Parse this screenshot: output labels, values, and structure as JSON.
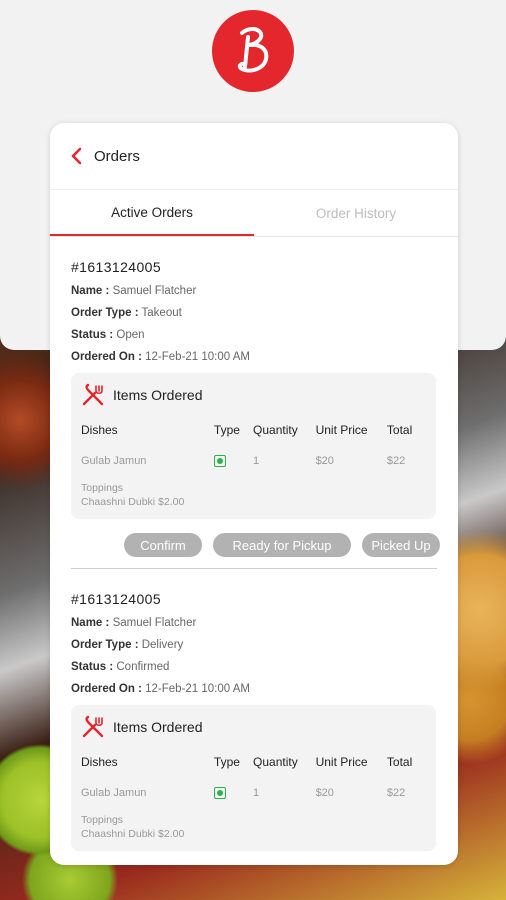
{
  "brand": {
    "color": "#e4262d",
    "logo_letter": "B"
  },
  "header": {
    "title": "Orders",
    "back_icon": "chevron-left-icon"
  },
  "tabs": [
    {
      "label": "Active Orders",
      "active": true
    },
    {
      "label": "Order History",
      "active": false
    }
  ],
  "table_headers": {
    "dishes": "Dishes",
    "type": "Type",
    "quantity": "Quantity",
    "unit_price": "Unit Price",
    "total": "Total"
  },
  "items_title": "Items Ordered",
  "actions": {
    "confirm": "Confirm",
    "ready": "Ready for Pickup",
    "picked": "Picked Up"
  },
  "orders": [
    {
      "id": "#1613124005",
      "name_label": "Name :",
      "name": "Samuel Flatcher",
      "type_label": "Order Type :",
      "type": "Takeout",
      "status_label": "Status :",
      "status": "Open",
      "ordered_label": "Ordered On :",
      "ordered_on": "12-Feb-21 10:00 AM",
      "items": [
        {
          "dish": "Gulab Jamun",
          "veg": true,
          "quantity": "1",
          "unit_price": "$20",
          "total": "$22",
          "toppings_label": "Toppings",
          "toppings": "Chaashni Dubki $2.00"
        }
      ]
    },
    {
      "id": "#1613124005",
      "name_label": "Name :",
      "name": "Samuel Flatcher",
      "type_label": "Order Type :",
      "type": "Delivery",
      "status_label": "Status :",
      "status": "Confirmed",
      "ordered_label": "Ordered On :",
      "ordered_on": "12-Feb-21 10:00 AM",
      "items": [
        {
          "dish": "Gulab Jamun",
          "veg": true,
          "quantity": "1",
          "unit_price": "$20",
          "total": "$22",
          "toppings_label": "Toppings",
          "toppings": "Chaashni Dubki $2.00"
        }
      ]
    }
  ]
}
